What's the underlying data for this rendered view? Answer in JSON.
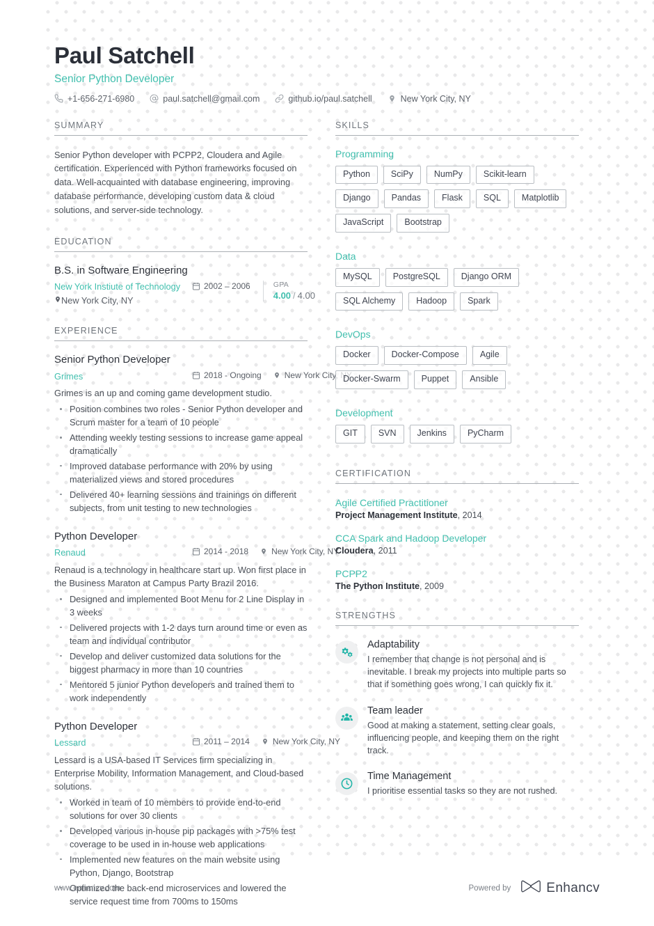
{
  "accent_color": "#41bfae",
  "text_color": "#3f4450",
  "header": {
    "name": "Paul Satchell",
    "job_title": "Senior Python Developer",
    "contacts": [
      {
        "icon": "phone-icon",
        "text": "+1-656-271-6980"
      },
      {
        "icon": "email-icon",
        "text": "paul.satchell@gmail.com"
      },
      {
        "icon": "link-icon",
        "text": "github.io/paul.satchell"
      },
      {
        "icon": "location-pin-icon",
        "text": "New York City, NY"
      }
    ]
  },
  "summary": {
    "title": "SUMMARY",
    "text": "Senior Python developer with PCPP2, Cloudera and Agile certification. Experienced with Python frameworks focused on data. Well-acquainted with database engineering, improving database performance, developing custom data & cloud solutions, and server-side technology."
  },
  "education": {
    "title": "EDUCATION",
    "entries": [
      {
        "degree": "B.S. in Software Engineering",
        "school": "New York Instiute of Technology",
        "location": "New York City, NY",
        "dates": "2002 – 2006",
        "gpa_label": "GPA",
        "gpa_value": "4.00",
        "gpa_separator": "/",
        "gpa_max": "4.00"
      }
    ]
  },
  "experience": {
    "title": "EXPERIENCE",
    "entries": [
      {
        "role": "Senior Python Developer",
        "company": "Grimes",
        "dates": "2018 - Ongoing",
        "location": "New York City, NY",
        "description": "Grimes is an up and coming game development studio.",
        "bullets": [
          "Position combines two roles - Senior Python developer and Scrum master for a team of 10 people",
          "Attending weekly testing sessions to increase game appeal dramatically",
          "Improved database performance with 20% by using materialized views and stored procedures",
          "Delivered 40+ learning sessions and trainings on different subjects, from unit testing to new technologies"
        ]
      },
      {
        "role": "Python Developer",
        "company": "Renaud",
        "dates": "2014 - 2018",
        "location": "New York City, NY",
        "description": "Renaud is a technology in healthcare start up. Won first place in the Business Maraton at Campus Party Brazil 2016.",
        "bullets": [
          "Designed and implemented Boot Menu for 2 Line Display in 3 weeks",
          "Delivered projects with 1-2 days turn around time or even as team and individual contributor",
          "Develop and deliver customized data solutions for the biggest pharmacy in more than 10 countries",
          "Mentored 5 junior Python developers and trained them to work independently"
        ]
      },
      {
        "role": "Python Developer",
        "company": "Lessard",
        "dates": "2011 – 2014",
        "location": "New York City, NY",
        "description": "Lessard is a USA-based IT Services firm specializing in Enterprise Mobility, Information Management, and Cloud-based solutions.",
        "bullets": [
          "Worked in team of 10 members to provide end-to-end solutions for over 30 clients",
          "Developed various in-house pip packages with >75% test coverage to be used in in-house web applications",
          "Implemented new features on the main website using Python, Django, Bootstrap",
          "Optimized the back-end microservices and lowered the service request time from 700ms to 150ms"
        ]
      }
    ]
  },
  "skills": {
    "title": "SKILLS",
    "groups": [
      {
        "name": "Programming",
        "items": [
          "Python",
          "SciPy",
          "NumPy",
          "Scikit-learn",
          "Django",
          "Pandas",
          "Flask",
          "SQL",
          "Matplotlib",
          "JavaScript",
          "Bootstrap"
        ]
      },
      {
        "name": "Data",
        "items": [
          "MySQL",
          "PostgreSQL",
          "Django ORM",
          "SQL Alchemy",
          "Hadoop",
          "Spark"
        ]
      },
      {
        "name": "DevOps",
        "items": [
          "Docker",
          "Docker-Compose",
          "Agile",
          "Docker-Swarm",
          "Puppet",
          "Ansible"
        ]
      },
      {
        "name": "Development",
        "items": [
          "GIT",
          "SVN",
          "Jenkins",
          "PyCharm"
        ]
      }
    ]
  },
  "certification": {
    "title": "CERTIFICATION",
    "entries": [
      {
        "name": "Agile Certified Practitioner",
        "issuer": "Project Management Institute",
        "year": "2014"
      },
      {
        "name": "CCA Spark and Hadoop Developer",
        "issuer": "Cloudera",
        "year": "2011"
      },
      {
        "name": "PCPP2",
        "issuer": "The Python Institute",
        "year": "2009"
      }
    ]
  },
  "strengths": {
    "title": "STRENGTHS",
    "entries": [
      {
        "icon": "gears-icon",
        "name": "Adaptability",
        "text": "I remember that change is not personal and is inevitable. I break my projects into multiple parts so that if something goes wrong, I can quickly fix it."
      },
      {
        "icon": "users-group-icon",
        "name": "Team leader",
        "text": "Good at making a statement, setting clear goals, influencing people, and keeping them on the right track."
      },
      {
        "icon": "clock-icon",
        "name": "Time Management",
        "text": "I prioritise essential tasks so they are not rushed."
      }
    ]
  },
  "footer": {
    "url": "www.enhancv.com",
    "powered_by": "Powered by",
    "brand": "Enhancv"
  }
}
